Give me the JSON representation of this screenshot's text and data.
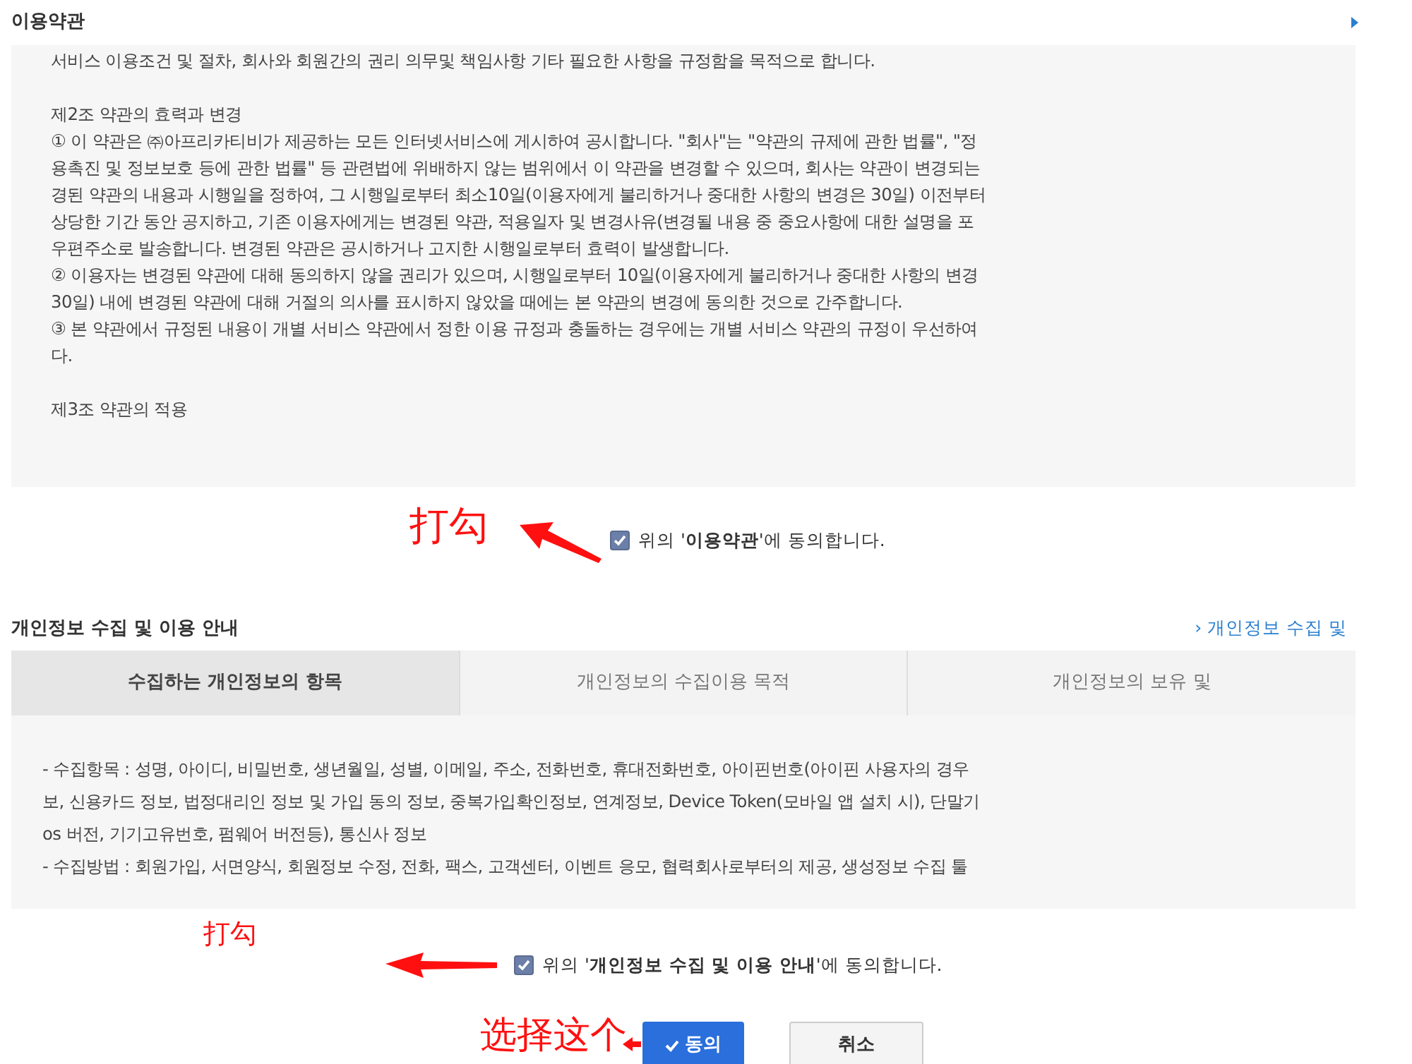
{
  "terms": {
    "title": "이용약관",
    "blocks": [
      [
        "서비스 이용조건 및 절차, 회사와 회원간의 권리 의무및 책임사항 기타 필요한 사항을 규정함을 목적으로 합니다."
      ],
      [
        "제2조 약관의 효력과 변경",
        "① 이 약관은 ㈜아프리카티비가 제공하는 모든 인터넷서비스에 게시하여 공시합니다. \"회사\"는 \"약관의 규제에 관한 법률\", \"정",
        "용촉진 및 정보보호 등에 관한 법률\" 등 관련법에 위배하지 않는 범위에서 이 약관을 변경할 수 있으며, 회사는 약관이 변경되는",
        "경된 약관의 내용과 시행일을 정하여, 그 시행일로부터 최소10일(이용자에게 불리하거나 중대한 사항의 변경은 30일) 이전부터",
        "상당한 기간 동안 공지하고, 기존 이용자에게는 변경된 약관, 적용일자 및 변경사유(변경될 내용 중 중요사항에 대한 설명을 포",
        "우편주소로 발송합니다. 변경된 약관은 공시하거나 고지한 시행일로부터 효력이 발생합니다.",
        "② 이용자는 변경된 약관에 대해 동의하지 않을 권리가 있으며, 시행일로부터 10일(이용자에게 불리하거나 중대한 사항의 변경",
        "30일) 내에 변경된 약관에 대해 거절의 의사를 표시하지 않았을 때에는 본 약관의 변경에 동의한 것으로 간주합니다.",
        "③ 본 약관에서 규정된 내용이 개별 서비스 약관에서 정한 이용 규정과 충돌하는 경우에는 개별 서비스 약관의 규정이 우선하여",
        "다."
      ],
      [
        "제3조 약관의 적용"
      ]
    ],
    "agree": {
      "label": "위의 '**이용약관**'에 동의합니다.",
      "checked": true
    }
  },
  "privacy": {
    "title": "개인정보 수집 및 이용 안내",
    "link": "› 개인정보 수집 및",
    "tabs": [
      {
        "label": "수집하는 개인정보의 항목",
        "selected": true
      },
      {
        "label": "개인정보의 수집이용 목적",
        "selected": false
      },
      {
        "label": "개인정보의 보유 및",
        "selected": false
      }
    ],
    "lines": [
      "- 수집항목 : 성명, 아이디, 비밀번호, 생년월일, 성별, 이메일, 주소, 전화번호, 휴대전화번호, 아이핀번호(아이핀 사용자의 경우",
      "보, 신용카드 정보, 법정대리인 정보 및 가입 동의 정보, 중복가입확인정보, 연계정보, Device Token(모바일 앱 설치 시), 단말기",
      "os 버전, 기기고유번호, 펌웨어 버전등), 통신사 정보",
      "- 수집방법 : 회원가입, 서면양식, 회원정보 수정, 전화, 팩스, 고객센터, 이벤트 응모, 협력회사로부터의 제공, 생성정보 수집 툴"
    ],
    "agree": {
      "label": "위의 '**개인정보 수집 및 이용 안내**'에 동의합니다.",
      "checked": true
    }
  },
  "buttons": [
    {
      "label": "동의",
      "kind": "primary"
    },
    {
      "label": "취소",
      "kind": "secondary"
    }
  ],
  "annotations": [
    "打勾",
    "打勾",
    "选择这个"
  ]
}
